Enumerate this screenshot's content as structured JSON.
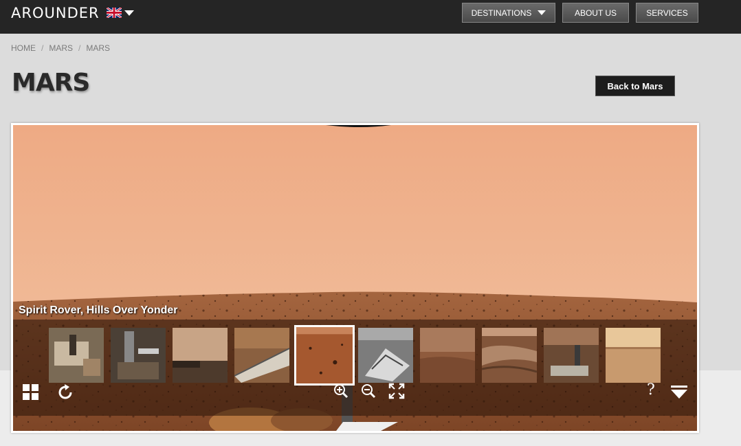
{
  "header": {
    "logo": "AROUNDER",
    "nav": {
      "destinations": "DESTINATIONS",
      "about": "ABOUT US",
      "services": "SERVICES"
    }
  },
  "breadcrumb": [
    "HOME",
    "/",
    "MARS",
    "/",
    "MARS"
  ],
  "page": {
    "title": "MARS",
    "back_button": "Back to Mars"
  },
  "viewer": {
    "caption": "Spirit Rover, Hills Over Yonder",
    "thumbnails": [
      {
        "subject": "rover deck",
        "active": false
      },
      {
        "subject": "rover mast",
        "active": false
      },
      {
        "subject": "plain horizon",
        "active": false
      },
      {
        "subject": "solar panel",
        "active": false
      },
      {
        "subject": "rocky ground",
        "active": true
      },
      {
        "subject": "lander grayscale",
        "active": false
      },
      {
        "subject": "dusty slope",
        "active": false
      },
      {
        "subject": "crater rim",
        "active": false
      },
      {
        "subject": "rover on terrain",
        "active": false
      },
      {
        "subject": "sunlit plain",
        "active": false
      }
    ],
    "controls": {
      "help": "?"
    }
  },
  "colors": {
    "header_bg": "#252525",
    "page_bg": "#dcdcdc",
    "mars_sky": "#eaaa80",
    "mars_ground": "#9a5a34"
  }
}
